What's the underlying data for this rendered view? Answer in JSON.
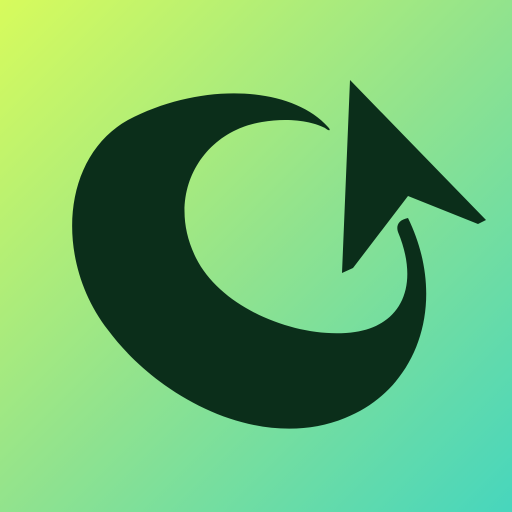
{
  "icon": {
    "name": "refresh-arrow-icon",
    "colors": {
      "gradient_start": "#d7fb5c",
      "gradient_mid": "#92e38d",
      "gradient_end": "#47d6bd",
      "glyph": "#0b2e1a"
    }
  }
}
